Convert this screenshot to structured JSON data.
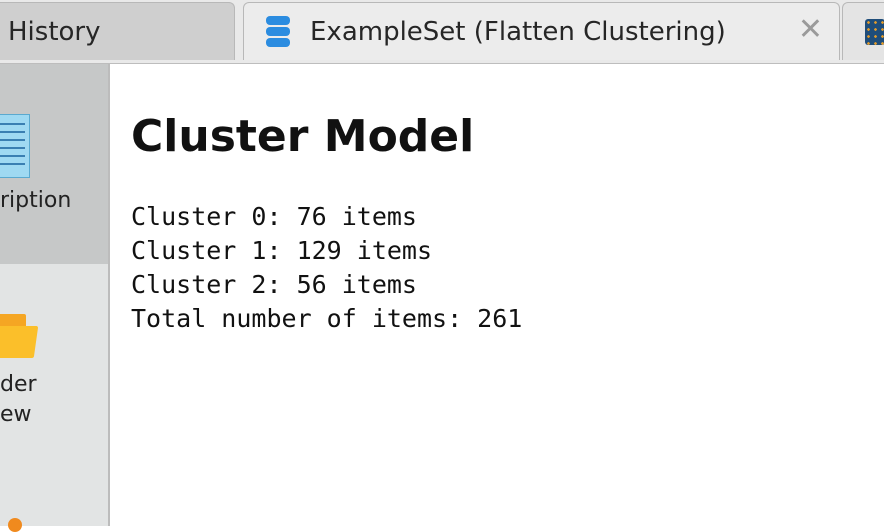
{
  "tabs": {
    "history_label": "History",
    "exampleset_label": "ExampleSet (Flatten Clustering)"
  },
  "sidebar": {
    "description_label": "ription",
    "folder_label_line1": "der",
    "folder_label_line2": "ew"
  },
  "main": {
    "title": "Cluster Model",
    "lines": [
      "Cluster 0: 76 items",
      "Cluster 1: 129 items",
      "Cluster 2: 56 items",
      "Total number of items: 261"
    ]
  },
  "colors": {
    "accent_blue": "#2b8ce0",
    "folder_orange": "#fbbf2a",
    "sidebar_selected": "#c6c8c8"
  }
}
